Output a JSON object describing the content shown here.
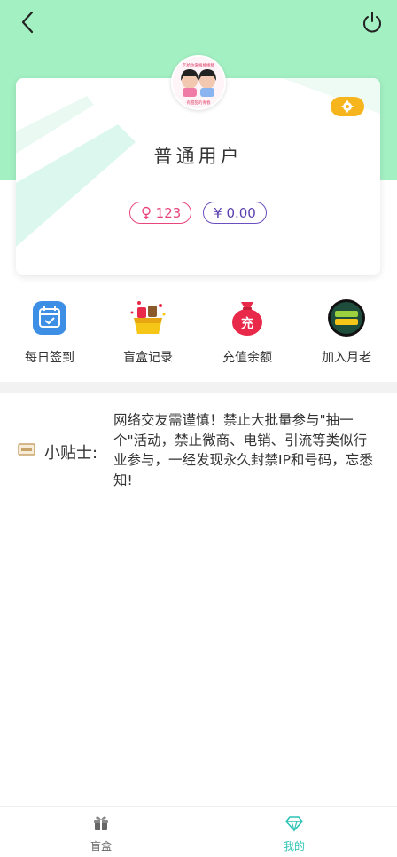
{
  "header": {
    "back_icon": "chevron-left-icon",
    "power_icon": "power-icon"
  },
  "profile": {
    "avatar_caption_1": "乞给你来根棒棒糖",
    "avatar_caption_2": "有甜甜的青春",
    "username": "普通用户",
    "gender_value": "123",
    "balance_value": "¥ 0.00",
    "settings_icon": "gear-icon"
  },
  "menu": {
    "items": [
      {
        "label": "每日签到",
        "icon": "calendar-check-icon",
        "color": "#3d8fe6"
      },
      {
        "label": "盲盒记录",
        "icon": "gift-box-icon",
        "color": "#f5c518"
      },
      {
        "label": "充值余额",
        "icon": "money-bag-icon",
        "color": "#e8294a"
      },
      {
        "label": "加入月老",
        "icon": "matchmaker-badge-icon",
        "color": "#1e4d3c"
      }
    ]
  },
  "tips": {
    "title": "小贴士:",
    "text": "网络交友需谨慎！禁止大批量参与\"抽一个\"活动，禁止微商、电销、引流等类似行业参与，一经发现永久封禁IP和号码，忘悉知!"
  },
  "tabbar": {
    "tabs": [
      {
        "label": "盲盒",
        "icon": "gift-icon",
        "active": false
      },
      {
        "label": "我的",
        "icon": "diamond-icon",
        "active": true
      }
    ]
  },
  "colors": {
    "header_bg": "#a3f0c3",
    "accent_teal": "#2ec4b6",
    "settings_orange": "#f6b51c",
    "gender_pink": "#e8457b",
    "balance_purple": "#6b4fbf"
  }
}
